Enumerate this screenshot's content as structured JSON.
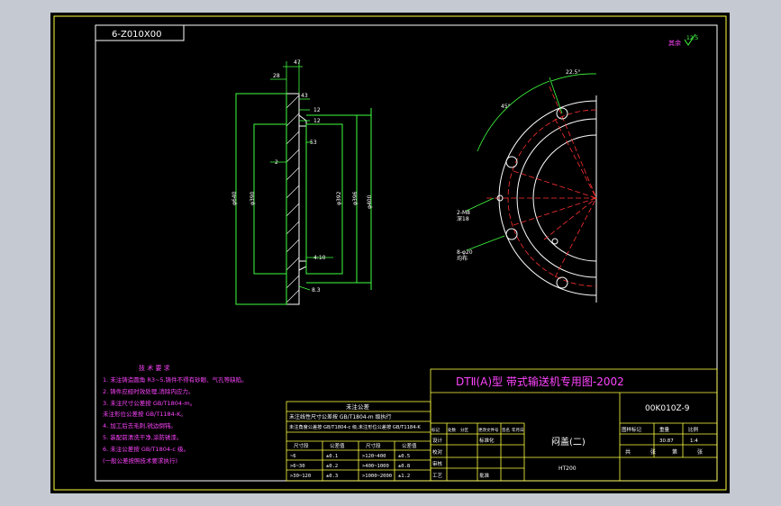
{
  "corner_code": "6-Z010X00",
  "roughness_note": "其余",
  "roughness_value": "12.5",
  "side_view": {
    "dims": {
      "d_outer": "φ640",
      "d_inner_left": "φ390",
      "d_middle": "φ392",
      "d_right1": "φ396",
      "d_right2": "φ400"
    },
    "thk_top": "47",
    "labels": [
      "28",
      "43",
      "12",
      "12",
      "53",
      "2",
      "8.3"
    ],
    "slope": "4:10"
  },
  "front_view": {
    "angle_top": "22.5°",
    "angle_left": "45°",
    "hole_note_1": [
      "2-M8",
      "深18"
    ],
    "hole_note_2": [
      "8-φ20",
      "均布"
    ]
  },
  "tech_req": {
    "title": "技 术 要 求",
    "items": [
      "1. 未注铸造圆角 R3~5,铸件不得有砂眼、气孔等缺陷。",
      "2. 铸件应经时效处理,消除内应力。",
      "3. 未注尺寸公差按 GB/T1804-m。",
      "   未注形位公差按 GB/T1184-K。",
      "4. 加工后去毛刺,锐边倒钝。",
      "5. 装配前清洗干净,涂防锈漆。",
      "6. 未注公差按 GB/T1804-c 级。",
      "   (一般公差按照技术要求执行)"
    ]
  },
  "tol_table": {
    "title": "未注公差",
    "note1": "未注线性尺寸公差按 GB/T1804-m 级执行",
    "note2": "未注角度公差按 GB/T1804-c 级,未注形位公差按 GB/T1184-K",
    "header": [
      "尺寸段",
      "公差值",
      "尺寸段",
      "公差值"
    ],
    "rows": [
      [
        "~6",
        "±0.1",
        ">120~400",
        "±0.5"
      ],
      [
        ">6~30",
        "±0.2",
        ">400~1000",
        "±0.8"
      ],
      [
        ">30~120",
        "±0.3",
        ">1000~2000",
        "±1.2"
      ]
    ]
  },
  "title_block": {
    "main_title": "DTⅡ(A)型 带式输送机专用图-2002",
    "drawing_no": "00K010Z-9",
    "part_name": "闷盖(二)",
    "material": "HT200",
    "stage_label": "图样标记",
    "weight_label": "重量",
    "scale_label": "比例",
    "weight": "30.87",
    "scale": "1:4",
    "sheet_label": "共",
    "sheet2_label": "张",
    "of_label": "第",
    "rev_headers": [
      "标记",
      "处数",
      "分区",
      "更改文件号",
      "签名",
      "年月日"
    ],
    "role_labels": [
      "设计",
      "校对",
      "审核",
      "工艺",
      "标准化",
      "批准"
    ]
  }
}
